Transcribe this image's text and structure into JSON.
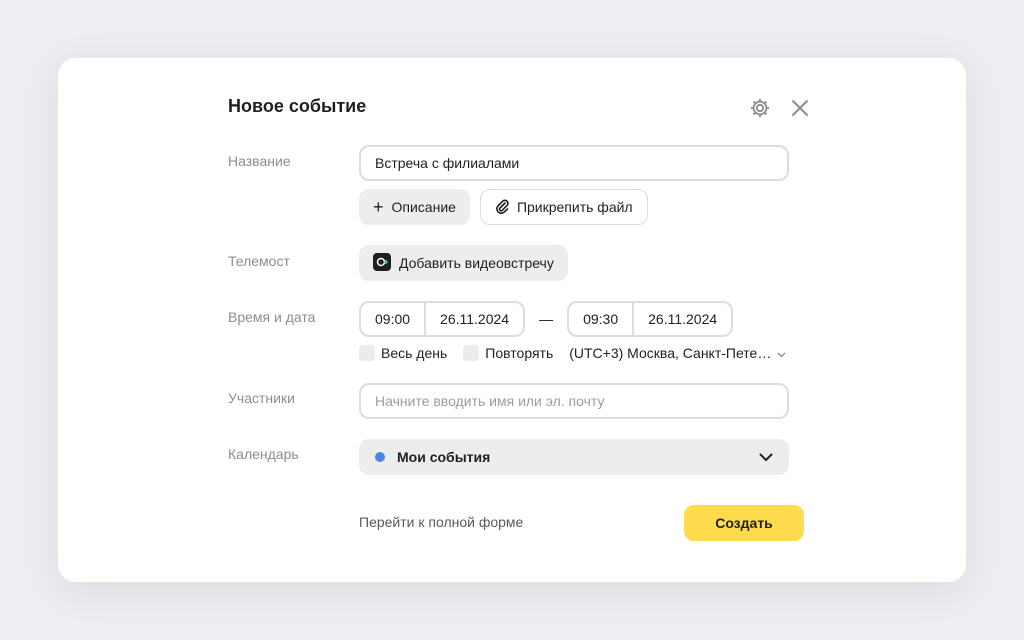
{
  "dialog": {
    "title": "Новое событие",
    "header_icons": [
      "gear-icon",
      "close-icon"
    ]
  },
  "fields": {
    "name": {
      "label": "Название",
      "value": "Встреча с филиалами",
      "add_description_label": "Описание",
      "attach_file_label": "Прикрепить файл"
    },
    "telemost": {
      "label": "Телемост",
      "add_video_label": "Добавить видеовстречу"
    },
    "datetime": {
      "label": "Время и дата",
      "start_time": "09:00",
      "start_date": "26.11.2024",
      "separator": "—",
      "end_time": "09:30",
      "end_date": "26.11.2024",
      "all_day_label": "Весь день",
      "repeat_label": "Повторять",
      "timezone": "(UTC+3) Москва, Санкт-Пете…"
    },
    "participants": {
      "label": "Участники",
      "placeholder": "Начните вводить имя или эл. почту"
    },
    "calendar": {
      "label": "Календарь",
      "selected": "Мои события",
      "dot_color": "#4b86e4"
    }
  },
  "footer": {
    "full_form_link": "Перейти к полной форме",
    "create_label": "Создать",
    "create_color": "#ffdb4d"
  }
}
